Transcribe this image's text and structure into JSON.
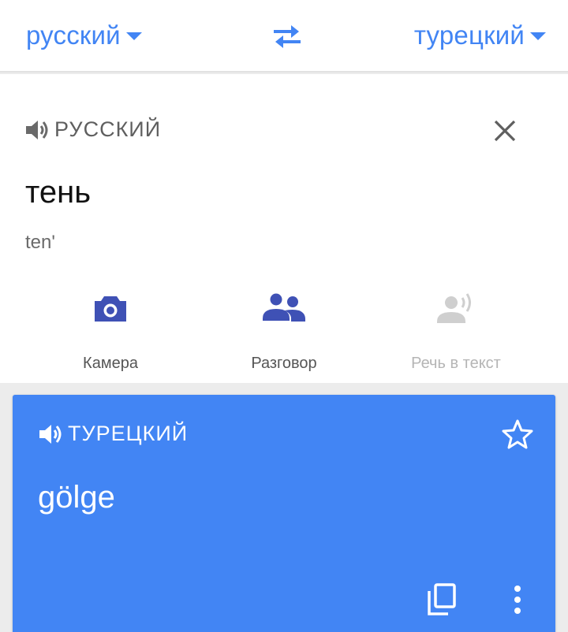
{
  "language_bar": {
    "source_language": "русский",
    "target_language": "турецкий",
    "swap_icon": "swap-arrows-icon"
  },
  "source": {
    "language_label": "РУССКИЙ",
    "text": "тень",
    "transliteration": "ten'",
    "tools": [
      {
        "label": "Камера",
        "icon": "camera-icon",
        "enabled": true
      },
      {
        "label": "Разговор",
        "icon": "conversation-icon",
        "enabled": true
      },
      {
        "label": "Речь в текст",
        "icon": "speech-to-text-icon",
        "enabled": false
      }
    ]
  },
  "result": {
    "language_label": "ТУРЕЦКИЙ",
    "text": "gölge"
  },
  "colors": {
    "accent": "#4285f4",
    "result_card": "#4285f4",
    "tool_icon": "#3f51b5",
    "disabled": "#b5b5b5"
  }
}
